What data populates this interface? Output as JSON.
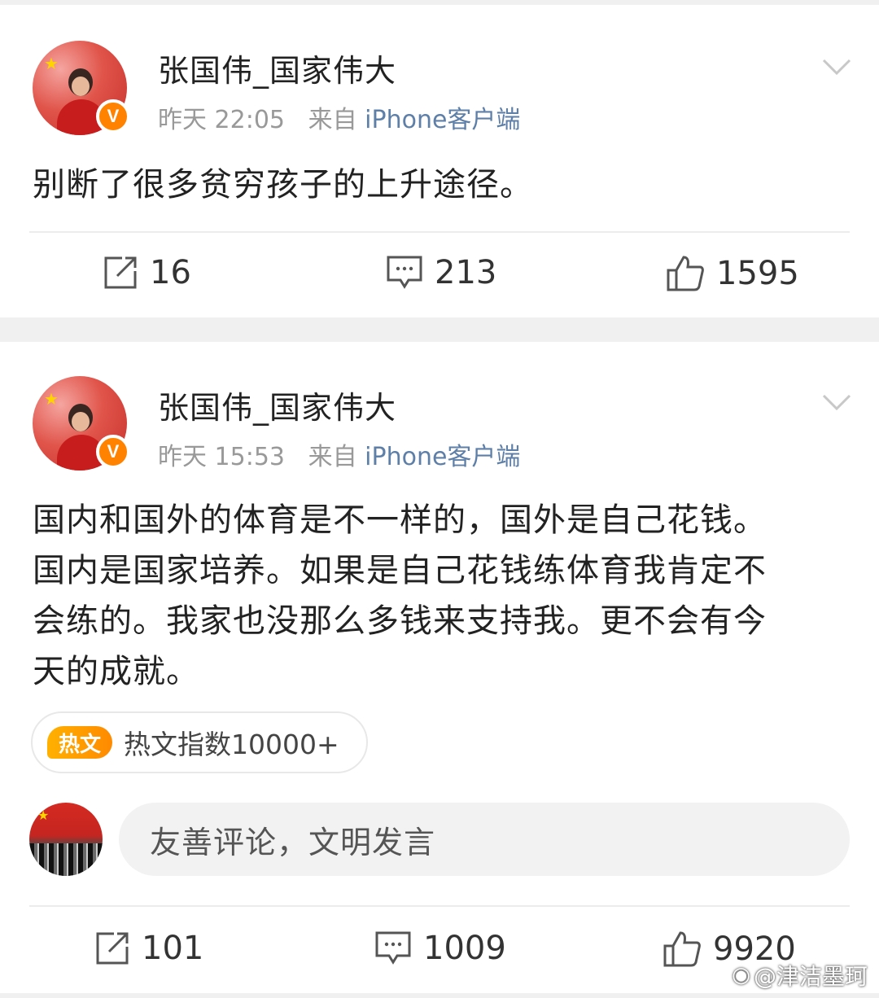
{
  "posts": [
    {
      "username": "张国伟_国家伟大",
      "time": "昨天 22:05",
      "source_prefix": "来自",
      "source": "iPhone客户端",
      "text": "别断了很多贫穷孩子的上升途径。",
      "reposts": "16",
      "comments": "213",
      "likes": "1595"
    },
    {
      "username": "张国伟_国家伟大",
      "time": "昨天 15:53",
      "source_prefix": "来自",
      "source": "iPhone客户端",
      "text_lines": [
        "国内和国外的体育是不一样的，国外是自己花钱。",
        "国内是国家培养。如果是自己花钱练体育我肯定不",
        "会练的。我家也没那么多钱来支持我。更不会有今",
        "天的成就。"
      ],
      "hot_badge": "热文",
      "hot_text": "热文指数10000+",
      "comment_placeholder": "友善评论，文明发言",
      "reposts": "101",
      "comments": "1009",
      "likes": "9920"
    }
  ],
  "verified_badge": "V",
  "watermark": "@津洁墨珂",
  "colors": {
    "source_link": "#5d7fa8",
    "verified": "#ff8200",
    "hot_badge": "#ff9a00"
  }
}
